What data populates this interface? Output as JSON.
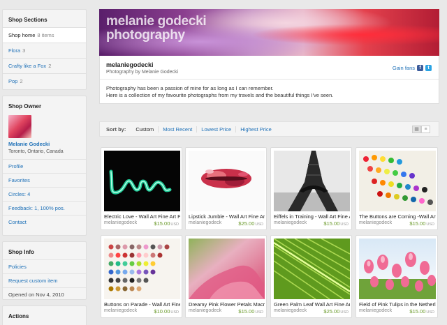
{
  "sections": {
    "title": "Shop Sections",
    "items": [
      {
        "label": "Shop home",
        "count": "8 items"
      },
      {
        "label": "Flora",
        "count": "3"
      },
      {
        "label": "Crafty like a Fox",
        "count": "2"
      },
      {
        "label": "Pop",
        "count": "2"
      }
    ]
  },
  "owner": {
    "title": "Shop Owner",
    "name": "Melanie Godecki",
    "location": "Toronto, Ontario, Canada",
    "links": [
      "Profile",
      "Favorites",
      "Circles: 4",
      "Feedback: 1, 100% pos.",
      "Contact"
    ]
  },
  "shop_info": {
    "title": "Shop Info",
    "policies": "Policies",
    "request": "Request custom item",
    "opened": "Opened on Nov 4, 2010"
  },
  "actions": {
    "title": "Actions"
  },
  "banner": {
    "title_line1": "melanie godecki",
    "title_line2": "photography"
  },
  "shop": {
    "name": "melaniegodecki",
    "subtitle": "Photography by Melanie Godecki",
    "gain_fans": "Gain fans",
    "fb_glyph": "f",
    "tw_glyph": "t",
    "description_line1": "Photography has been a passion of mine for as long as I can remember.",
    "description_line2": "Here is a collection of my favourite photographs from my travels and the beautiful things I've seen."
  },
  "sort": {
    "label": "Sort by:",
    "options": [
      "Custom",
      "Most Recent",
      "Lowest Price",
      "Highest Price"
    ],
    "grid_icon": "▦",
    "list_icon": "≡"
  },
  "listings": [
    {
      "title": "Electric Love - Wall Art Fine Art P",
      "seller": "melaniegodeck",
      "price": "$15.00",
      "currency": "USD"
    },
    {
      "title": "Lipstick Jumble - Wall Art Fine Art",
      "seller": "melaniegodeck",
      "price": "$25.00",
      "currency": "USD"
    },
    {
      "title": "Eiffels in Training - Wall Art Fine A",
      "seller": "melaniegodeck",
      "price": "$15.00",
      "currency": "USD"
    },
    {
      "title": "The Buttons are Coming -Wall Art",
      "seller": "melaniegodeck",
      "price": "$15.00",
      "currency": "USD"
    },
    {
      "title": "Buttons on Parade - Wall Art Fine A",
      "seller": "melaniegodeck",
      "price": "$10.00",
      "currency": "USD"
    },
    {
      "title": "Dreamy Pink Flower Petals Macro",
      "seller": "melaniegodeck",
      "price": "$15.00",
      "currency": "USD"
    },
    {
      "title": "Green Palm Leaf Wall Art Fine Art",
      "seller": "melaniegodeck",
      "price": "$25.00",
      "currency": "USD"
    },
    {
      "title": "Field of Pink Tulips in the Netherla",
      "seller": "melaniegodeck",
      "price": "$15.00",
      "currency": "USD"
    }
  ]
}
